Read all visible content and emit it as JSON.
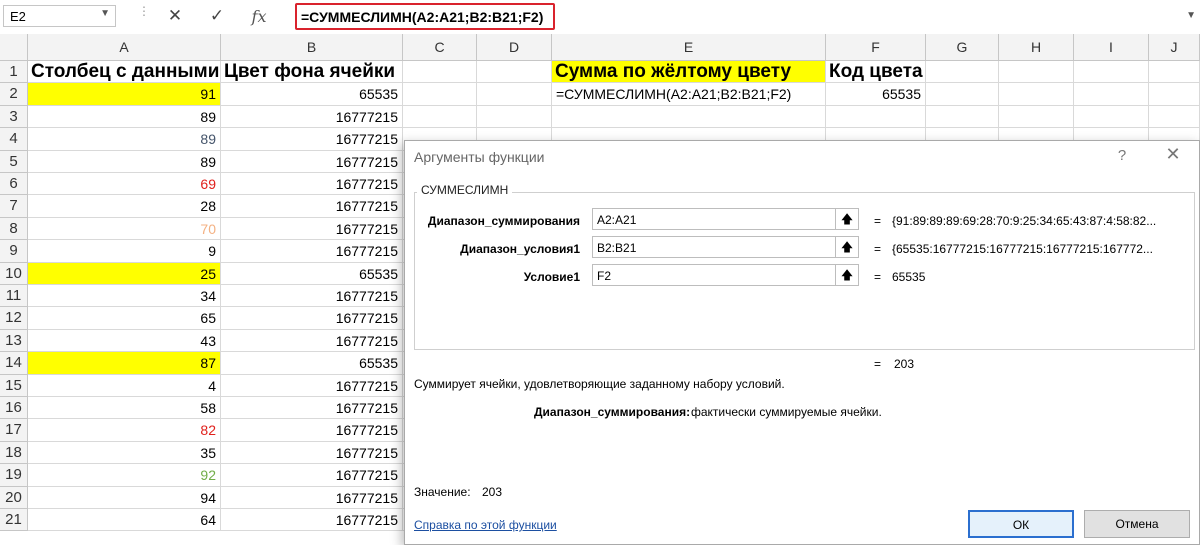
{
  "formula_bar": {
    "name_box": "E2",
    "cancel_icon": "✕",
    "enter_icon": "✓",
    "fx_label": "fx",
    "formula": "=СУММЕСЛИМН(A2:A21;B2:B21;F2)"
  },
  "columns": [
    "A",
    "B",
    "C",
    "D",
    "E",
    "F",
    "G",
    "H",
    "I",
    "J"
  ],
  "headers": {
    "a1": "Столбец с данными",
    "b1": "Цвет фона ячейки",
    "e1": "Сумма по жёлтому цвету",
    "f1": "Код цвета"
  },
  "e2": "=СУММЕСЛИМН(A2:A21;B2:B21;F2)",
  "f2": "65535",
  "rows": [
    {
      "n": "2",
      "a": "91",
      "b": "65535",
      "color": "#000000",
      "yellow": true
    },
    {
      "n": "3",
      "a": "89",
      "b": "16777215",
      "color": "#000000",
      "yellow": false
    },
    {
      "n": "4",
      "a": "89",
      "b": "16777215",
      "color": "#44546a",
      "yellow": false
    },
    {
      "n": "5",
      "a": "89",
      "b": "16777215",
      "color": "#000000",
      "yellow": false
    },
    {
      "n": "6",
      "a": "69",
      "b": "16777215",
      "color": "#e0201c",
      "yellow": false
    },
    {
      "n": "7",
      "a": "28",
      "b": "16777215",
      "color": "#000000",
      "yellow": false
    },
    {
      "n": "8",
      "a": "70",
      "b": "16777215",
      "color": "#f4b183",
      "yellow": false
    },
    {
      "n": "9",
      "a": "9",
      "b": "16777215",
      "color": "#000000",
      "yellow": false
    },
    {
      "n": "10",
      "a": "25",
      "b": "65535",
      "color": "#000000",
      "yellow": true
    },
    {
      "n": "11",
      "a": "34",
      "b": "16777215",
      "color": "#000000",
      "yellow": false
    },
    {
      "n": "12",
      "a": "65",
      "b": "16777215",
      "color": "#000000",
      "yellow": false
    },
    {
      "n": "13",
      "a": "43",
      "b": "16777215",
      "color": "#000000",
      "yellow": false
    },
    {
      "n": "14",
      "a": "87",
      "b": "65535",
      "color": "#000000",
      "yellow": true
    },
    {
      "n": "15",
      "a": "4",
      "b": "16777215",
      "color": "#000000",
      "yellow": false
    },
    {
      "n": "16",
      "a": "58",
      "b": "16777215",
      "color": "#000000",
      "yellow": false
    },
    {
      "n": "17",
      "a": "82",
      "b": "16777215",
      "color": "#e0201c",
      "yellow": false
    },
    {
      "n": "18",
      "a": "35",
      "b": "16777215",
      "color": "#000000",
      "yellow": false
    },
    {
      "n": "19",
      "a": "92",
      "b": "16777215",
      "color": "#70ad47",
      "yellow": false
    },
    {
      "n": "20",
      "a": "94",
      "b": "16777215",
      "color": "#000000",
      "yellow": false
    },
    {
      "n": "21",
      "a": "64",
      "b": "16777215",
      "color": "#000000",
      "yellow": false
    }
  ],
  "dialog": {
    "title": "Аргументы функции",
    "help": "?",
    "close": "✕",
    "function_name": "СУММЕСЛИМН",
    "args": [
      {
        "label": "Диапазон_суммирования",
        "value": "A2:A21",
        "eq": "=",
        "result": "{91:89:89:89:69:28:70:9:25:34:65:43:87:4:58:82..."
      },
      {
        "label": "Диапазон_условия1",
        "value": "B2:B21",
        "eq": "=",
        "result": "{65535:16777215:16777215:16777215:167772..."
      },
      {
        "label": "Условие1",
        "value": "F2",
        "eq": "=",
        "result": "65535"
      }
    ],
    "ref_icon": "🡅",
    "result_eq": "=",
    "result": "203",
    "description": "Суммирует ячейки, удовлетворяющие заданному набору условий.",
    "arg_desc_name": "Диапазон_суммирования:",
    "arg_desc_text": "фактически суммируемые ячейки.",
    "value_label": "Значение:",
    "value": "203",
    "help_link": "Справка по этой функции",
    "ok": "ОК",
    "cancel": "Отмена"
  }
}
